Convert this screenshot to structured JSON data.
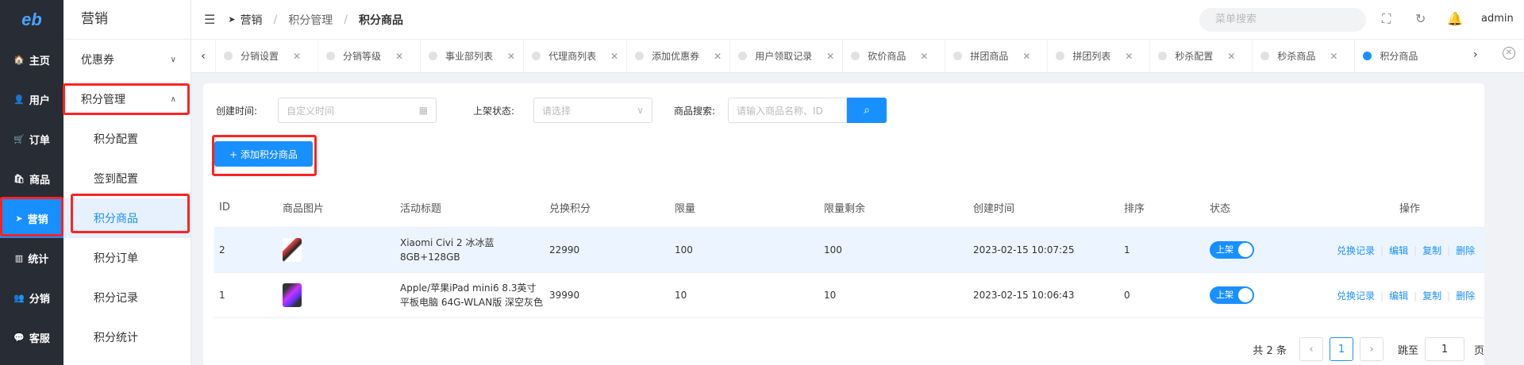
{
  "rail": {
    "logo": "eb",
    "items": [
      {
        "icon": "🏠",
        "label": "主页"
      },
      {
        "icon": "👤",
        "label": "用户"
      },
      {
        "icon": "🛒",
        "label": "订单"
      },
      {
        "icon": "🛍",
        "label": "商品"
      },
      {
        "icon": "➤",
        "label": "营销"
      },
      {
        "icon": "▥",
        "label": "统计"
      },
      {
        "icon": "👥",
        "label": "分销"
      },
      {
        "icon": "💬",
        "label": "客服"
      }
    ]
  },
  "submenu": {
    "title": "营销",
    "coupon": "优惠券",
    "points_group": "积分管理",
    "children": [
      "积分配置",
      "签到配置",
      "积分商品",
      "积分订单",
      "积分记录",
      "积分统计"
    ]
  },
  "topbar": {
    "breadcrumb": [
      "营销",
      "积分管理",
      "积分商品"
    ],
    "search_placeholder": "菜单搜索",
    "user": "admin"
  },
  "tabs": [
    "分销设置",
    "分销等级",
    "事业部列表",
    "代理商列表",
    "添加优惠券",
    "用户领取记录",
    "砍价商品",
    "拼团商品",
    "拼团列表",
    "秒杀配置",
    "秒杀商品",
    "积分商品"
  ],
  "filters": {
    "created_label": "创建时间:",
    "created_placeholder": "自定义时间",
    "status_label": "上架状态:",
    "status_placeholder": "请选择",
    "search_label": "商品搜索:",
    "search_placeholder": "请输入商品名称、ID"
  },
  "add_button": "+ 添加积分商品",
  "table": {
    "headers": [
      "ID",
      "商品图片",
      "活动标题",
      "兑换积分",
      "限量",
      "限量剩余",
      "创建时间",
      "排序",
      "状态",
      "操作"
    ],
    "rows": [
      {
        "id": "2",
        "title": "Xiaomi Civi 2 冰冰蓝 8GB+128GB",
        "points": "22990",
        "limit": "100",
        "remaining": "100",
        "created": "2023-02-15 10:07:25",
        "sort": "1",
        "status": "上架"
      },
      {
        "id": "1",
        "title": "Apple/苹果iPad mini6 8.3英寸平板电脑 64G-WLAN版 深空灰色",
        "points": "39990",
        "limit": "10",
        "remaining": "10",
        "created": "2023-02-15 10:06:43",
        "sort": "0",
        "status": "上架"
      }
    ],
    "ops": [
      "兑换记录",
      "编辑",
      "复制",
      "删除"
    ]
  },
  "pager": {
    "total": "共 2 条",
    "page": "1",
    "jump_label": "跳至",
    "jump_value": "1",
    "page_suffix": "页"
  }
}
